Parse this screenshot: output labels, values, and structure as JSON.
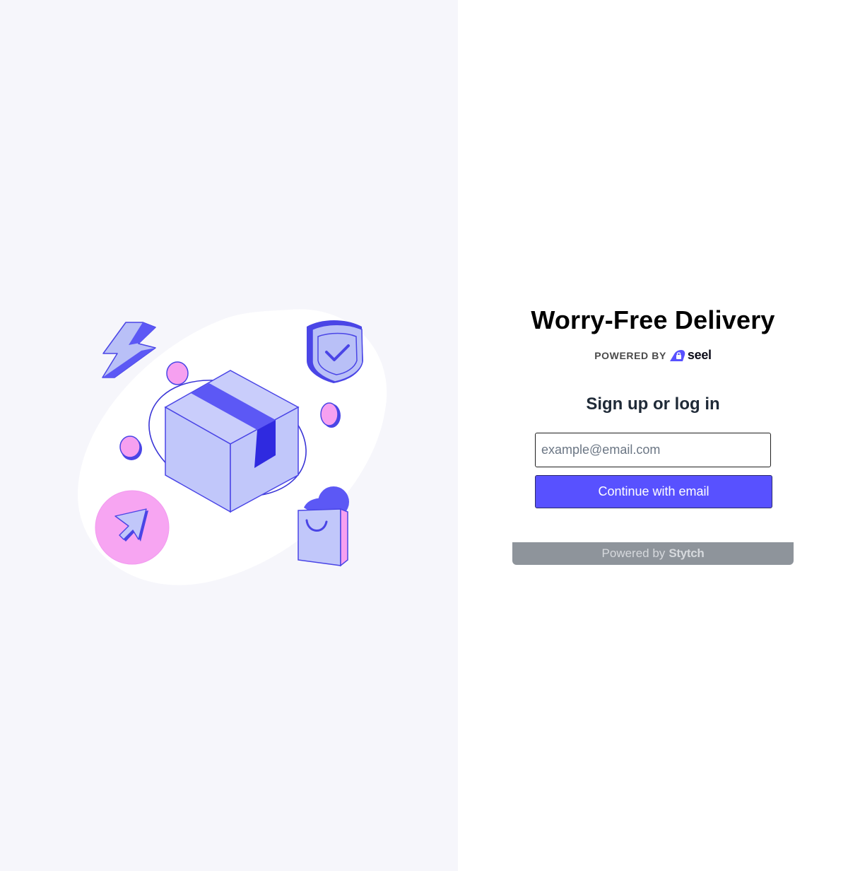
{
  "header": {
    "title": "Worry-Free Delivery",
    "powered_by": "POWERED BY",
    "brand": "seel"
  },
  "form": {
    "heading": "Sign up or log in",
    "email_placeholder": "example@email.com",
    "email_value": "",
    "continue_label": "Continue with email"
  },
  "footer": {
    "powered_by": "Powered by",
    "brand": "Stytch"
  },
  "colors": {
    "accent": "#5851ff",
    "left_background": "#f6f6fb",
    "footer_bar": "#8e949b"
  },
  "illustration": {
    "icons": [
      "lightning-icon",
      "shield-check-icon",
      "package-box-icon",
      "cursor-arrow-icon",
      "shopping-bag-icon",
      "coin-icon"
    ]
  }
}
